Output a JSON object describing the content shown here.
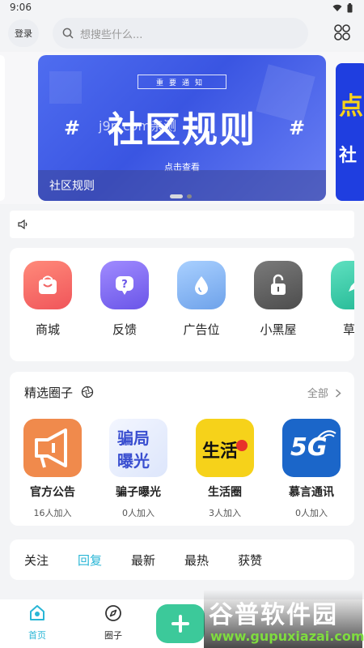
{
  "status": {
    "time": "9:06"
  },
  "header": {
    "login_label": "登录",
    "search_placeholder": "想搜些什么..."
  },
  "banner": {
    "notice": "重要通知",
    "title": "社区规则",
    "watermark": "j9p.com亲测",
    "click_hint": "点击查看",
    "caption": "社区规则",
    "side_text_1": "点",
    "side_text_2": "社"
  },
  "functions": [
    {
      "label": "商城",
      "icon": "shopping-bag-icon",
      "color": "#f26a6a"
    },
    {
      "label": "反馈",
      "icon": "question-bubble-icon",
      "color": "#7a6cf0"
    },
    {
      "label": "广告位",
      "icon": "drop-icon",
      "color": "#6fa8ec"
    },
    {
      "label": "小黑屋",
      "icon": "unlocked-lock-icon",
      "color": "#5f5f5f"
    },
    {
      "label": "草稿",
      "icon": "draft-icon",
      "color": "#2fc7a8"
    }
  ],
  "circles": {
    "title": "精选圈子",
    "all_label": "全部",
    "items": [
      {
        "name": "官方公告",
        "count": "16人加入",
        "color": "#f08a4c"
      },
      {
        "name": "骗子曝光",
        "count": "0人加入",
        "color": "#e8eefc",
        "icon_text_1": "骗局",
        "icon_text_2": "曝光"
      },
      {
        "name": "生活圈",
        "count": "3人加入",
        "color": "#f6d21a",
        "icon_text_1": "生活"
      },
      {
        "name": "慕言通讯",
        "count": "0人加入",
        "color": "#1b66c9",
        "icon_text_1": "5G"
      }
    ]
  },
  "tabs": [
    "关注",
    "回复",
    "最新",
    "最热",
    "获赞"
  ],
  "active_tab": "回复",
  "nav": {
    "home_label": "首页",
    "circles_label": "圈子"
  },
  "brand_watermark": {
    "text_1": "谷普软件园",
    "text_2": "www.gupuxiazai.com"
  },
  "colors": {
    "accent": "#29b6d6",
    "green": "#3cc99a",
    "banner": "#3a55e2"
  }
}
